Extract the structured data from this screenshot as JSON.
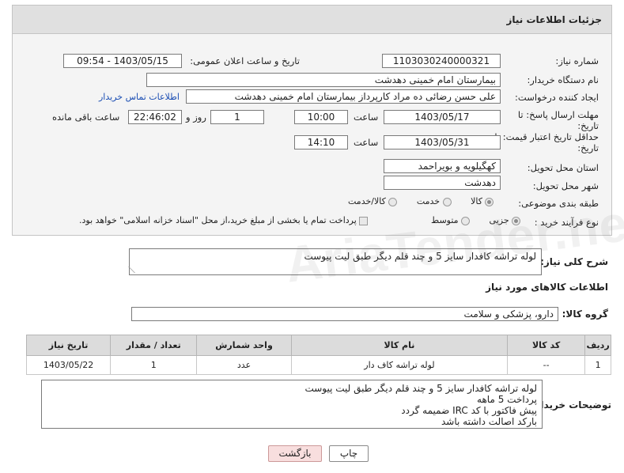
{
  "header": {
    "title": "جزئیات اطلاعات نیاز"
  },
  "form": {
    "need_number": {
      "label": "شماره نیاز:",
      "value": "1103030240000321"
    },
    "announce_datetime": {
      "label": "تاریخ و ساعت اعلان عمومی:",
      "value": "1403/05/15 - 09:54"
    },
    "buyer_org": {
      "label": "نام دستگاه خریدار:",
      "value": "بیمارستان امام خمینی دهدشت"
    },
    "requester": {
      "label": "ایجاد کننده درخواست:",
      "value": "علی حسن رضائی ده مراد کارپرداز بیمارستان امام خمینی دهدشت",
      "contact_link": "اطلاعات تماس خریدار"
    },
    "reply_deadline": {
      "label": "مهلت ارسال پاسخ: تا تاریخ:",
      "date": "1403/05/17",
      "time_label": "ساعت",
      "time": "10:00",
      "days": "1",
      "days_label": "روز و",
      "remaining": "22:46:02",
      "remaining_label": "ساعت باقی مانده"
    },
    "price_validity": {
      "label": "حداقل تاریخ اعتبار قیمت: تا تاریخ:",
      "date": "1403/05/31",
      "time_label": "ساعت",
      "time": "14:10"
    },
    "province": {
      "label": "استان محل تحویل:",
      "value": "کهگیلویه و بویراحمد"
    },
    "city": {
      "label": "شهر محل تحویل:",
      "value": "دهدشت"
    },
    "category": {
      "label": "طبقه بندی موضوعی:",
      "options": [
        "کالا",
        "خدمت",
        "کالا/خدمت"
      ],
      "selected": "کالا"
    },
    "purchase_process": {
      "label": "نوع فرآیند خرید :",
      "options": [
        "جزیی",
        "متوسط"
      ],
      "selected": "جزیی",
      "payment_note": "پرداخت تمام یا بخشی از مبلغ خرید،از محل \"اسناد خزانه اسلامی\" خواهد بود."
    }
  },
  "description": {
    "label": "شرح کلی نیاز:",
    "value": "لوله تراشه کافدار سایز 5 و چند قلم دیگر طبق لیت پیوست"
  },
  "goods_info": {
    "title": "اطلاعات کالاهای مورد نیاز"
  },
  "goods_group": {
    "label": "گروه کالا:",
    "value": "دارو، پزشکی و سلامت"
  },
  "table": {
    "headers": [
      "ردیف",
      "کد کالا",
      "نام کالا",
      "واحد شمارش",
      "تعداد / مقدار",
      "تاریخ نیاز"
    ],
    "rows": [
      [
        "1",
        "--",
        "لوله تراشه کاف دار",
        "عدد",
        "1",
        "1403/05/22"
      ]
    ]
  },
  "buyer_notes": {
    "label": "توضیحات خریدار:",
    "lines": [
      "لوله تراشه کافدار سایز 5 و چند قلم دیگر طبق لیت پیوست",
      "پرداخت 5 ماهه",
      "پیش فاکتور با کد IRC ضمیمه گردد",
      "بارکد اصالت داشته باشد"
    ]
  },
  "buttons": {
    "print": "چاپ",
    "back": "بازگشت"
  },
  "watermark": "AriaTender.net"
}
